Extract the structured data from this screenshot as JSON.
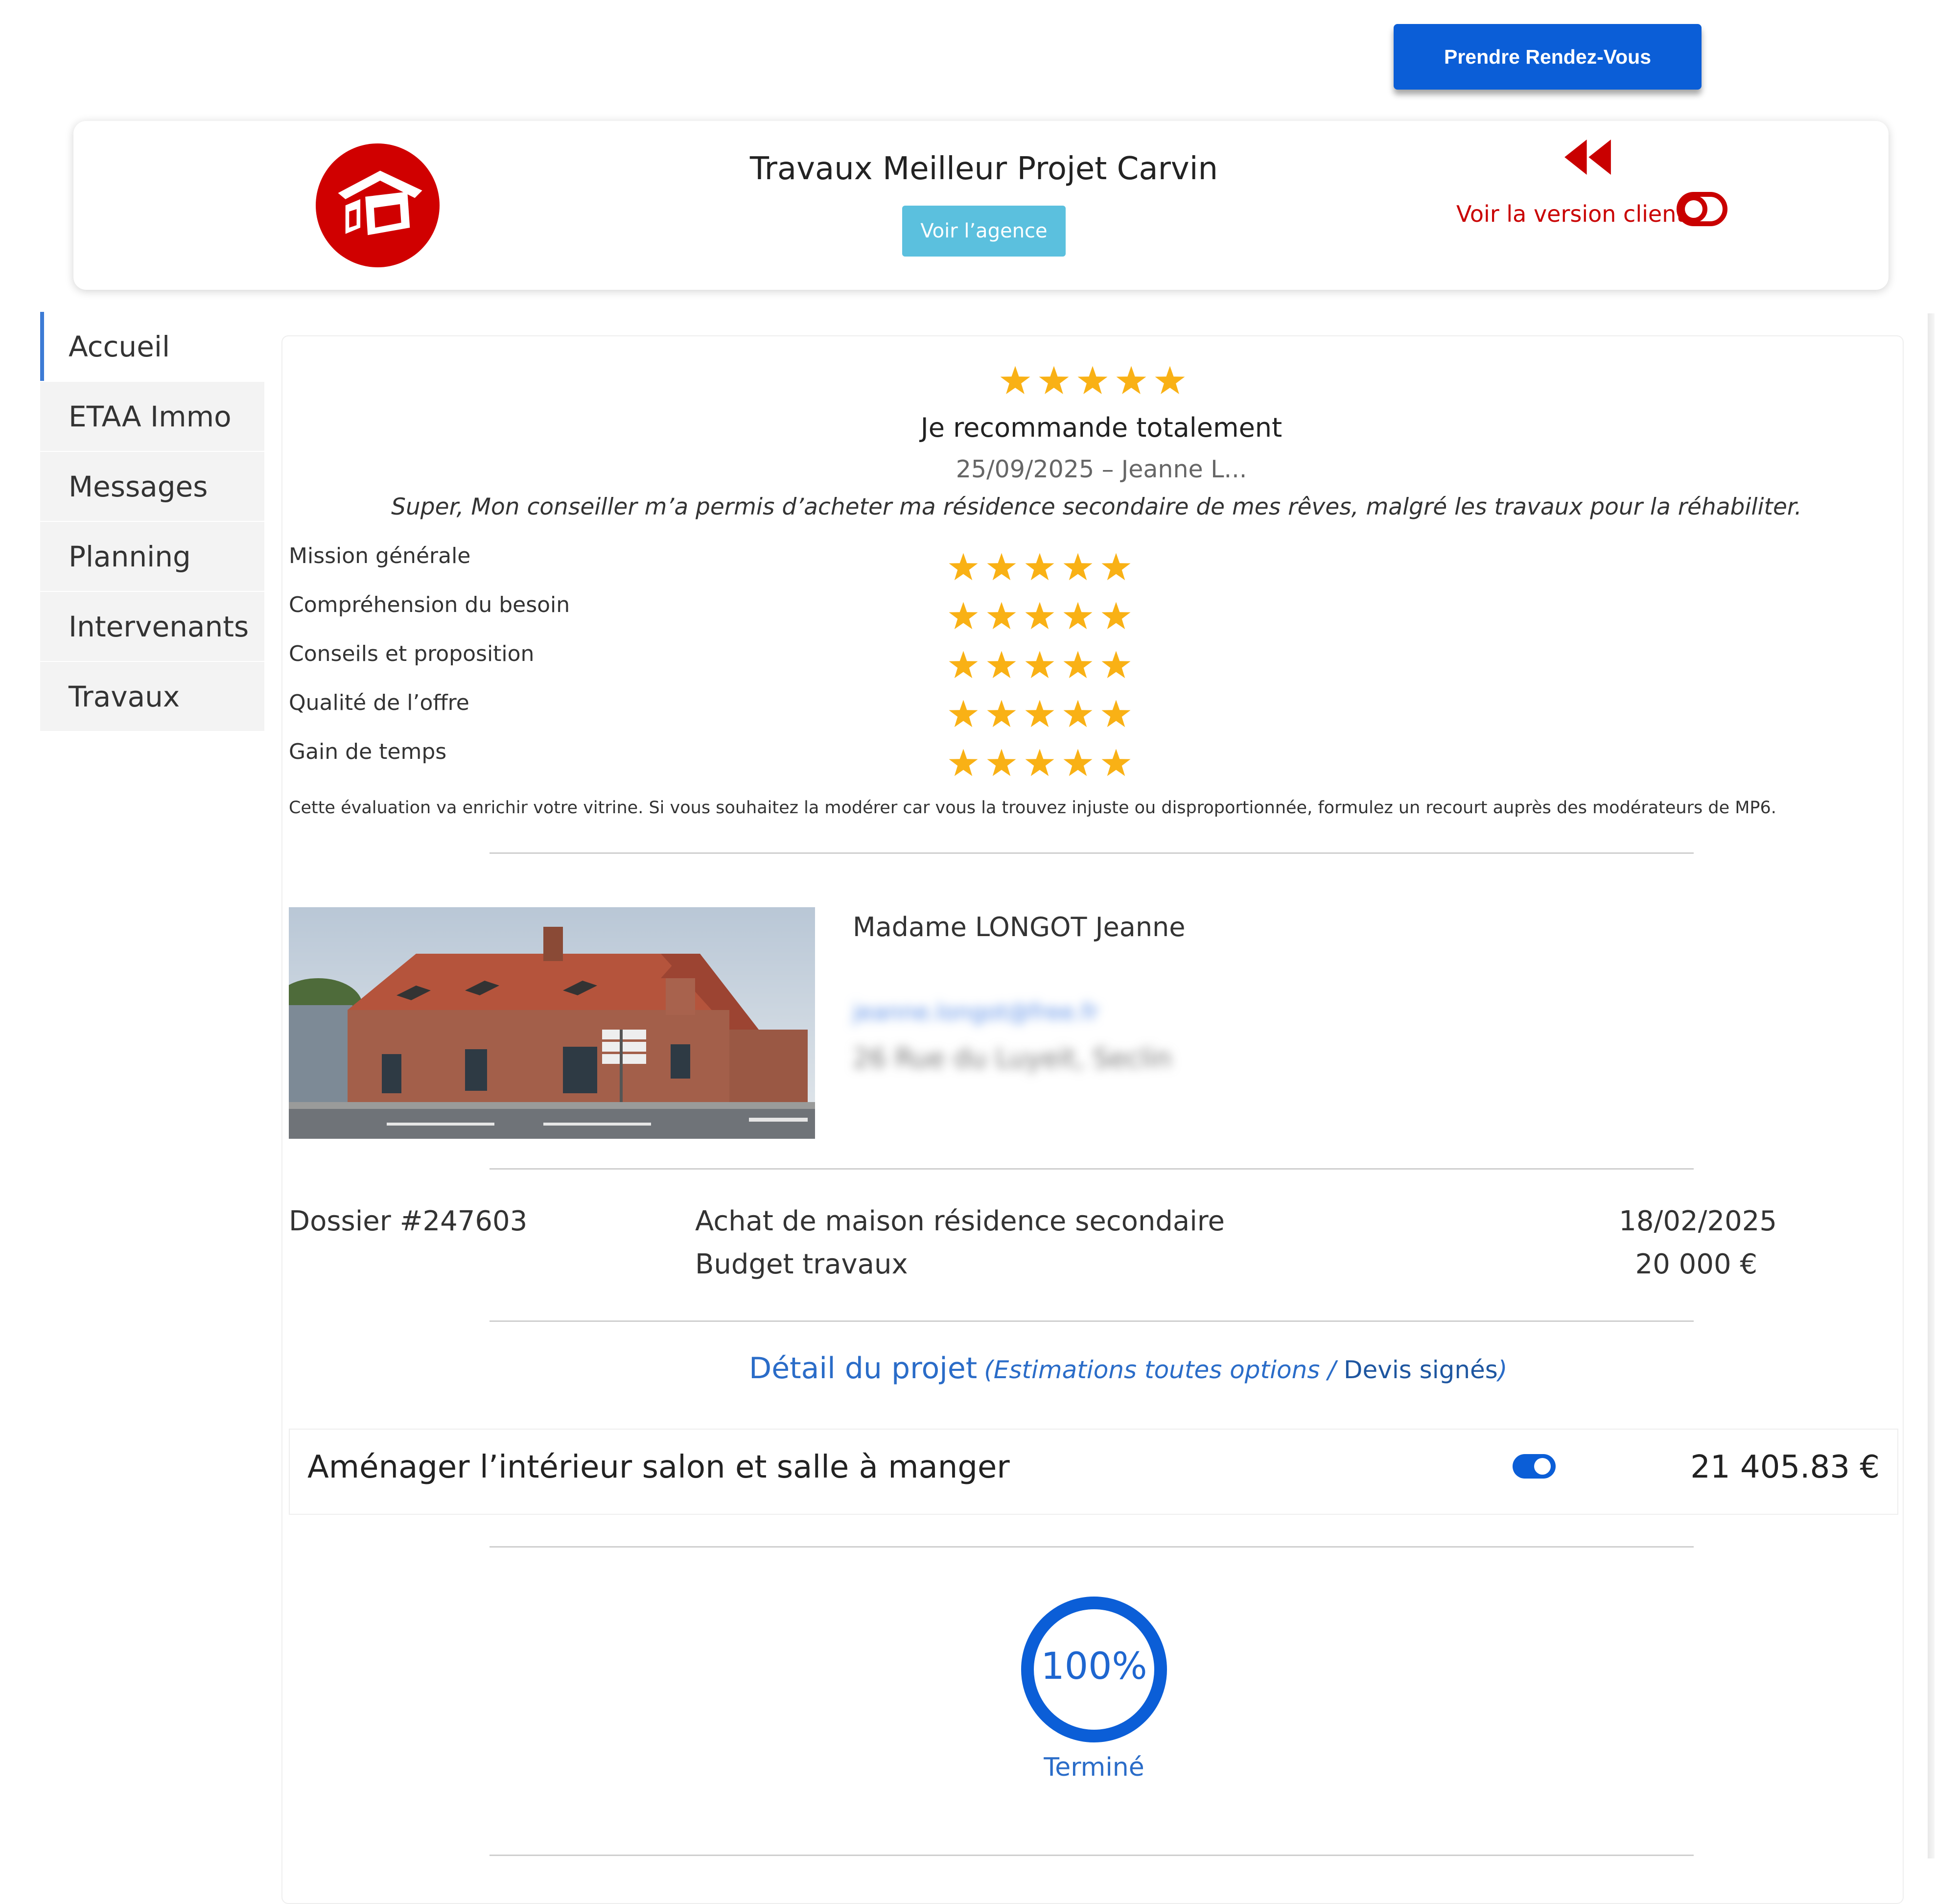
{
  "header": {
    "appointment_button": "Prendre Rendez-Vous",
    "agency_name": "Travaux Meilleur Projet Carvin",
    "agency_button": "Voir l’agence",
    "client_version_link": "Voir la version client",
    "logo_icon": "house-logo-icon",
    "rewind_icon": "rewind-icon",
    "toggle_icon": "toggle-icon",
    "brand_color": "#d00000",
    "accent_color": "#0b5ed7"
  },
  "sidebar": {
    "items": [
      {
        "label": "Accueil"
      },
      {
        "label": "ETAA Immo"
      },
      {
        "label": "Messages"
      },
      {
        "label": "Planning"
      },
      {
        "label": "Intervenants"
      },
      {
        "label": "Travaux"
      }
    ],
    "active": "Accueil"
  },
  "review": {
    "rating": 5,
    "rating_max": 5,
    "title": "Je recommande totalement",
    "meta": "25/09/2025 – Jeanne L...",
    "text": "Super, Mon conseiller m’a permis d’acheter ma résidence secondaire de mes rêves, malgré les travaux pour la réhabiliter.",
    "criteria": [
      {
        "label": "Mission générale",
        "rating": 5
      },
      {
        "label": "Compréhension du besoin",
        "rating": 5
      },
      {
        "label": "Conseils et proposition",
        "rating": 5
      },
      {
        "label": "Qualité de l’offre",
        "rating": 5
      },
      {
        "label": "Gain de temps",
        "rating": 5
      }
    ],
    "disclaimer": "Cette évaluation va enrichir votre vitrine. Si vous souhaitez la modérer car vous la trouvez injuste ou disproportionnée, formulez un recourt auprès des modérateurs de MP6.",
    "star_color": "#f9b115"
  },
  "client": {
    "name": "Madame LONGOT Jeanne",
    "email": "jeanne.longot@free.fr",
    "address": "26 Rue du Luyeit, Seclin"
  },
  "dossier": {
    "number": "Dossier #247603",
    "type": "Achat de maison résidence secondaire",
    "date": "18/02/2025",
    "budget_label": "Budget travaux",
    "budget_value": "20 000 €"
  },
  "project": {
    "detail_title": "Détail du projet",
    "detail_open": "(",
    "detail_estimations": "Estimations toutes options /",
    "detail_devis": "Devis signés",
    "detail_close": ")",
    "work_title": "Aménager l’intérieur salon et salle à manger",
    "work_amount": "21 405.83 €",
    "work_toggle_on": true
  },
  "progress": {
    "value": 100,
    "label": "100%",
    "status": "Terminé",
    "color": "#0b5ed7"
  }
}
